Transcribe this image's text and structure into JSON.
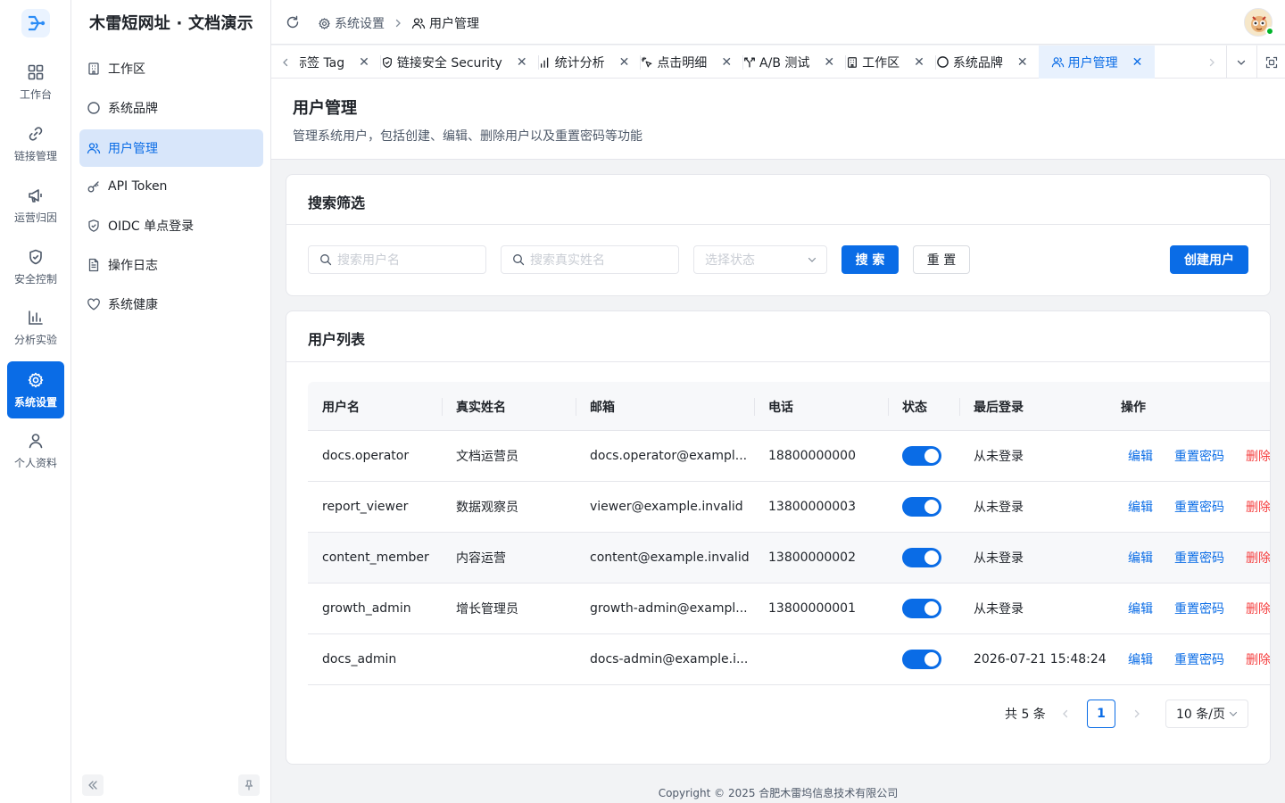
{
  "app": {
    "title": "木雷短网址 · 文档演示"
  },
  "rail": {
    "items": [
      {
        "label": "工作台",
        "icon": "dashboard-icon"
      },
      {
        "label": "链接管理",
        "icon": "link-icon"
      },
      {
        "label": "运营归因",
        "icon": "megaphone-icon"
      },
      {
        "label": "安全控制",
        "icon": "shield-check-icon"
      },
      {
        "label": "分析实验",
        "icon": "bar-chart-icon"
      },
      {
        "label": "系统设置",
        "icon": "gear-icon",
        "active": true
      },
      {
        "label": "个人资料",
        "icon": "user-icon"
      }
    ]
  },
  "sidebar": {
    "items": [
      {
        "label": "工作区",
        "icon": "building-icon"
      },
      {
        "label": "系统品牌",
        "icon": "circle-icon"
      },
      {
        "label": "用户管理",
        "icon": "users-icon",
        "active": true
      },
      {
        "label": "API Token",
        "icon": "key-icon"
      },
      {
        "label": "OIDC 单点登录",
        "icon": "shield-check-icon"
      },
      {
        "label": "操作日志",
        "icon": "document-icon"
      },
      {
        "label": "系统健康",
        "icon": "heart-icon"
      }
    ]
  },
  "header": {
    "breadcrumb": [
      {
        "label": "系统设置",
        "icon": "gear-icon"
      },
      {
        "label": "用户管理",
        "icon": "users-icon"
      }
    ]
  },
  "tabs": [
    {
      "label": "标签 Tag",
      "icon": "tag-icon"
    },
    {
      "label": "链接安全 Security",
      "icon": "shield-check-icon"
    },
    {
      "label": "统计分析",
      "icon": "bar-chart-icon"
    },
    {
      "label": "点击明细",
      "icon": "pointer-click-icon"
    },
    {
      "label": "A/B 测试",
      "icon": "split-icon"
    },
    {
      "label": "工作区",
      "icon": "building-icon"
    },
    {
      "label": "系统品牌",
      "icon": "circle-icon"
    },
    {
      "label": "用户管理",
      "icon": "users-icon",
      "active": true
    }
  ],
  "page": {
    "title": "用户管理",
    "description": "管理系统用户，包括创建、编辑、删除用户以及重置密码等功能"
  },
  "filter": {
    "title": "搜索筛选",
    "username_placeholder": "搜索用户名",
    "realname_placeholder": "搜索真实姓名",
    "status_placeholder": "选择状态",
    "search_label": "搜 索",
    "reset_label": "重 置",
    "create_label": "创建用户"
  },
  "list": {
    "title": "用户列表",
    "columns": [
      "用户名",
      "真实姓名",
      "邮箱",
      "电话",
      "状态",
      "最后登录",
      "操作"
    ],
    "actions": {
      "edit": "编辑",
      "reset": "重置密码",
      "delete": "删除"
    },
    "rows": [
      {
        "username": "docs.operator",
        "realname": "文档运营员",
        "email": "docs.operator@exampl...",
        "phone": "18800000000",
        "enabled": true,
        "last_login": "从未登录"
      },
      {
        "username": "report_viewer",
        "realname": "数据观察员",
        "email": "viewer@example.invalid",
        "phone": "13800000003",
        "enabled": true,
        "last_login": "从未登录"
      },
      {
        "username": "content_member",
        "realname": "内容运营",
        "email": "content@example.invalid",
        "phone": "13800000002",
        "enabled": true,
        "last_login": "从未登录"
      },
      {
        "username": "growth_admin",
        "realname": "增长管理员",
        "email": "growth-admin@exampl...",
        "phone": "13800000001",
        "enabled": true,
        "last_login": "从未登录"
      },
      {
        "username": "docs_admin",
        "realname": "",
        "email": "docs-admin@example.i...",
        "phone": "",
        "enabled": true,
        "last_login": "2026-07-21 15:48:24"
      }
    ]
  },
  "pagination": {
    "total_text": "共 5 条",
    "current_page": "1",
    "page_size": "10 条/页"
  },
  "footer": {
    "copyright": "Copyright © 2025 合肥木雷坞信息技术有限公司"
  },
  "colors": {
    "primary": "#0a6ce6",
    "danger": "#f53f3f",
    "success": "#00b42a"
  }
}
